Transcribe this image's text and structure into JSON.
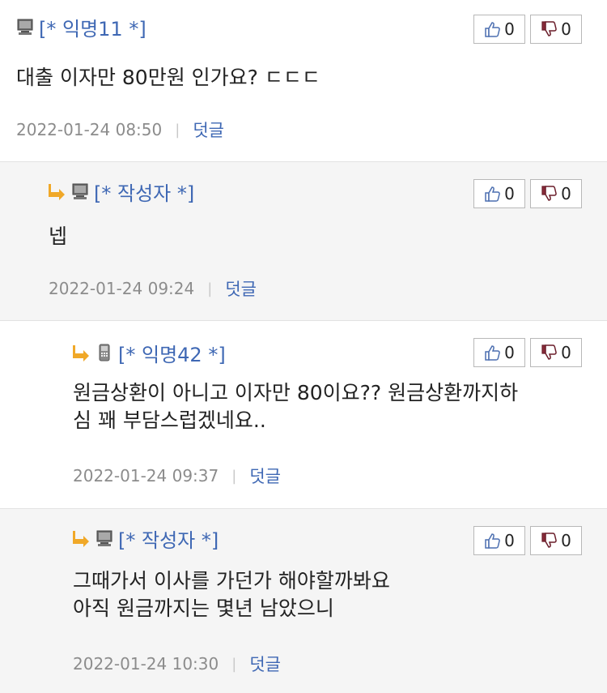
{
  "comments": [
    {
      "author": "[* 익명11 *]",
      "device": "desktop-icon",
      "is_reply": false,
      "lines": [
        "대출 이자만 80만원 인가요? ㄷㄷㄷ"
      ],
      "likes": "0",
      "dislikes": "0",
      "date": "2022-01-24 08:50",
      "reply_label": "덧글"
    },
    {
      "author": "[* 작성자 *]",
      "device": "desktop-icon",
      "is_reply": true,
      "lines": [
        "넵"
      ],
      "likes": "0",
      "dislikes": "0",
      "date": "2022-01-24 09:24",
      "reply_label": "덧글"
    },
    {
      "author": "[* 익명42 *]",
      "device": "mobile-phone-icon",
      "is_reply": true,
      "lines": [
        "원금상환이 아니고 이자만 80이요??  원금상환까지하",
        "심 꽤 부담스럽겠네요.."
      ],
      "likes": "0",
      "dislikes": "0",
      "date": "2022-01-24 09:37",
      "reply_label": "덧글"
    },
    {
      "author": "[* 작성자 *]",
      "device": "desktop-icon",
      "is_reply": true,
      "lines": [
        "그때가서 이사를 가던가 해야할까봐요",
        "아직 원금까지는 몇년 남았으니"
      ],
      "likes": "0",
      "dislikes": "0",
      "date": "2022-01-24 10:30",
      "reply_label": "덧글"
    }
  ],
  "colors": {
    "author": "#3f68b4",
    "reply_arrow": "#f0a828",
    "reply_bg": "#f5f5f5"
  }
}
